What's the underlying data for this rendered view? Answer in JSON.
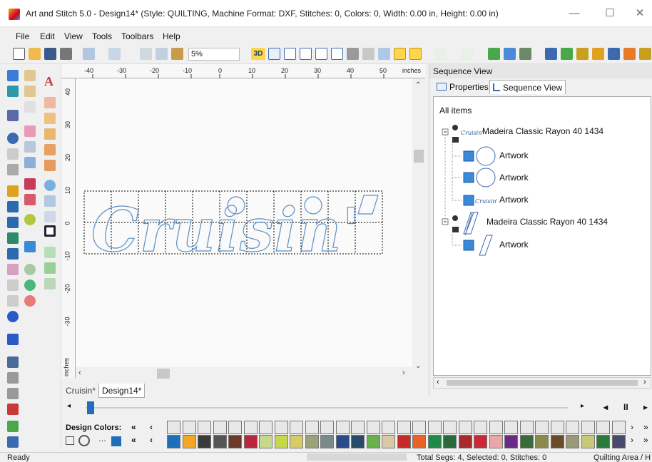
{
  "window": {
    "title": "Art and Stitch 5.0 - Design14* (Style: QUILTING, Machine Format: DXF, Stitches: 0, Colors: 0, Width: 0.00 in, Height: 0.00 in)",
    "minimize": "—",
    "maximize": "☐",
    "close": "✕"
  },
  "menu": [
    "File",
    "Edit",
    "View",
    "Tools",
    "Toolbars",
    "Help"
  ],
  "toolbar": {
    "zoom_value": "5%",
    "btn_3d": "3D"
  },
  "ruler": {
    "top_ticks": [
      "-40",
      "-30",
      "-20",
      "-10",
      "0",
      "10",
      "20",
      "30",
      "40",
      "50"
    ],
    "unit_top": "inches",
    "left_ticks": [
      "40",
      "30",
      "20",
      "10",
      "0",
      "-10",
      "-20",
      "-30"
    ],
    "unit_left": "inches"
  },
  "canvas": {
    "design_text": "Cruisin'"
  },
  "doc_tabs": [
    "Cruisin*",
    "Design14*"
  ],
  "sequence": {
    "panel_title": "Sequence View",
    "tabs": [
      "Properties",
      "Sequence View"
    ],
    "root": "All items",
    "groups": [
      {
        "label": "Madeira Classic Rayon 40 1434",
        "children": [
          "Artwork",
          "Artwork",
          "Artwork"
        ]
      },
      {
        "label": "Madeira Classic Rayon 40 1434",
        "children": [
          "Artwork"
        ]
      }
    ]
  },
  "palette": {
    "label": "Design Colors:",
    "top_row": [
      "#e8e8e8",
      "#e8e8e8",
      "#e8e8e8",
      "#e8e8e8",
      "#e8e8e8",
      "#e8e8e8",
      "#e8e8e8",
      "#e8e8e8",
      "#e8e8e8",
      "#e8e8e8",
      "#e8e8e8",
      "#e8e8e8",
      "#e8e8e8",
      "#e8e8e8",
      "#e8e8e8",
      "#e8e8e8",
      "#e8e8e8",
      "#e8e8e8",
      "#e8e8e8",
      "#e8e8e8",
      "#e8e8e8",
      "#e8e8e8",
      "#e8e8e8",
      "#e8e8e8",
      "#e8e8e8",
      "#e8e8e8",
      "#e8e8e8",
      "#e8e8e8",
      "#e8e8e8",
      "#e8e8e8"
    ],
    "bottom_row": [
      "#1e6fb8",
      "#f5a623",
      "#3a3a3a",
      "#555555",
      "#6b3a2a",
      "#b8283a",
      "#c8d88a",
      "#c7d94a",
      "#d8c96a",
      "#9aa27a",
      "#7a8a8a",
      "#2a4a8a",
      "#2a4a6a",
      "#6ab04c",
      "#d8c8a8",
      "#c82a2a",
      "#e8622a",
      "#1e8a4a",
      "#2a6a3a",
      "#a82a2a",
      "#c8283a",
      "#e8a8a8",
      "#6a2a8a",
      "#3a6a3a",
      "#8a8a4a",
      "#6a4a2a",
      "#9a9a7a",
      "#c8c87a",
      "#2a7a3a",
      "#4a4a6a"
    ]
  },
  "status": {
    "ready": "Ready",
    "totals": "Total Segs: 4, Selected: 0, Stitches: 0",
    "area": "Quilting Area / H"
  },
  "colors": {
    "accent": "#1e6fb8",
    "outline": "#5b8fc4"
  }
}
